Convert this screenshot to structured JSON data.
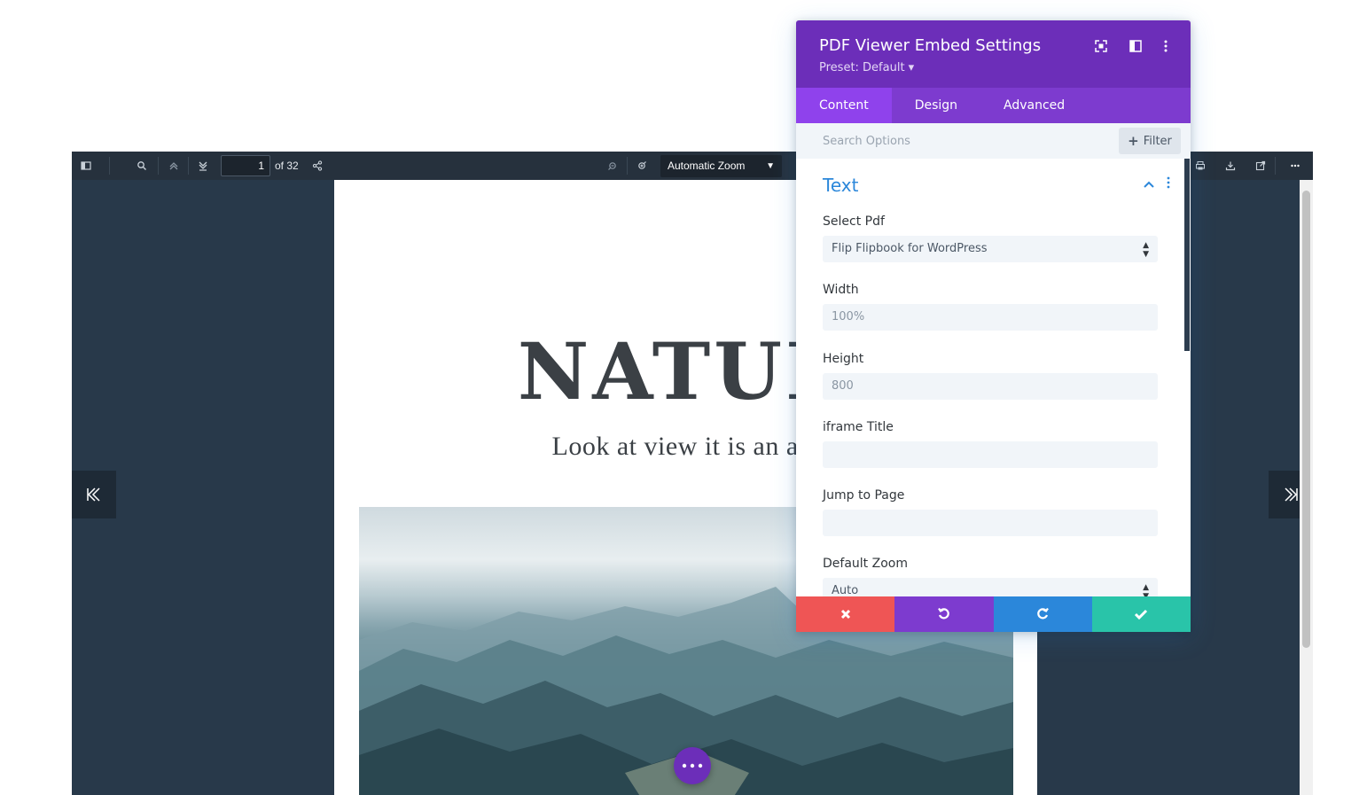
{
  "viewer": {
    "page_number": "1",
    "page_total": "of 32",
    "zoom": "Automatic Zoom"
  },
  "document": {
    "title": "NATUR",
    "subtitle": "Look at view it is an am"
  },
  "panel": {
    "title": "PDF Viewer Embed Settings",
    "preset": "Preset: Default ▾",
    "tabs": [
      "Content",
      "Design",
      "Advanced"
    ],
    "search_placeholder": "Search Options",
    "filter_label": "Filter",
    "section_title": "Text",
    "fields": {
      "select_pdf": {
        "label": "Select Pdf",
        "value": "Flip Flipbook for WordPress"
      },
      "width": {
        "label": "Width",
        "value": "100%"
      },
      "height": {
        "label": "Height",
        "value": "800"
      },
      "iframe_title": {
        "label": "iframe Title",
        "value": ""
      },
      "jump_to_page": {
        "label": "Jump to Page",
        "value": ""
      },
      "default_zoom": {
        "label": "Default Zoom",
        "value": "Auto"
      }
    }
  },
  "colors": {
    "panel_header": "#6c2eb9",
    "tab_bar": "#7d3bcf",
    "tab_active": "#8f42ec",
    "cancel": "#ef5555",
    "undo": "#7d3bcf",
    "redo": "#2b87da",
    "save": "#29c4a9",
    "accent": "#2b87da"
  }
}
